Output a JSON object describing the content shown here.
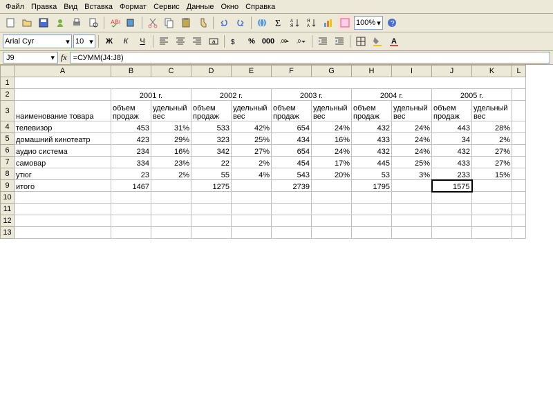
{
  "menu": {
    "file": "Файл",
    "edit": "Правка",
    "view": "Вид",
    "insert": "Вставка",
    "format": "Формат",
    "tools": "Сервис",
    "data": "Данные",
    "window": "Окно",
    "help": "Справка"
  },
  "toolbar": {
    "zoom": "100%"
  },
  "format": {
    "font": "Arial Cyr",
    "size": "10"
  },
  "cellref": {
    "active": "J9",
    "fx": "fx",
    "formula": "=СУММ(J4:J8)"
  },
  "cols": [
    "A",
    "B",
    "C",
    "D",
    "E",
    "F",
    "G",
    "H",
    "I",
    "J",
    "K",
    "L"
  ],
  "years": {
    "y1": "2001 г.",
    "y2": "2002 г.",
    "y3": "2003 г.",
    "y4": "2004 г.",
    "y5": "2005 г."
  },
  "hdr": {
    "name": "наименование товара",
    "vol": "объем продаж",
    "wt": "удельный вес"
  },
  "rows": [
    {
      "name": "телевизор",
      "b": "453",
      "c": "31%",
      "d": "533",
      "e": "42%",
      "f": "654",
      "g": "24%",
      "h": "432",
      "i": "24%",
      "j": "443",
      "k": "28%"
    },
    {
      "name": "домашний кинотеатр",
      "b": "423",
      "c": "29%",
      "d": "323",
      "e": "25%",
      "f": "434",
      "g": "16%",
      "h": "433",
      "i": "24%",
      "j": "34",
      "k": "2%"
    },
    {
      "name": "аудио система",
      "b": "234",
      "c": "16%",
      "d": "342",
      "e": "27%",
      "f": "654",
      "g": "24%",
      "h": "432",
      "i": "24%",
      "j": "432",
      "k": "27%"
    },
    {
      "name": "самовар",
      "b": "334",
      "c": "23%",
      "d": "22",
      "e": "2%",
      "f": "454",
      "g": "17%",
      "h": "445",
      "i": "25%",
      "j": "433",
      "k": "27%"
    },
    {
      "name": "утюг",
      "b": "23",
      "c": "2%",
      "d": "55",
      "e": "4%",
      "f": "543",
      "g": "20%",
      "h": "53",
      "i": "3%",
      "j": "233",
      "k": "15%"
    }
  ],
  "total": {
    "name": "итого",
    "b": "1467",
    "d": "1275",
    "f": "2739",
    "h": "1795",
    "j": "1575"
  }
}
